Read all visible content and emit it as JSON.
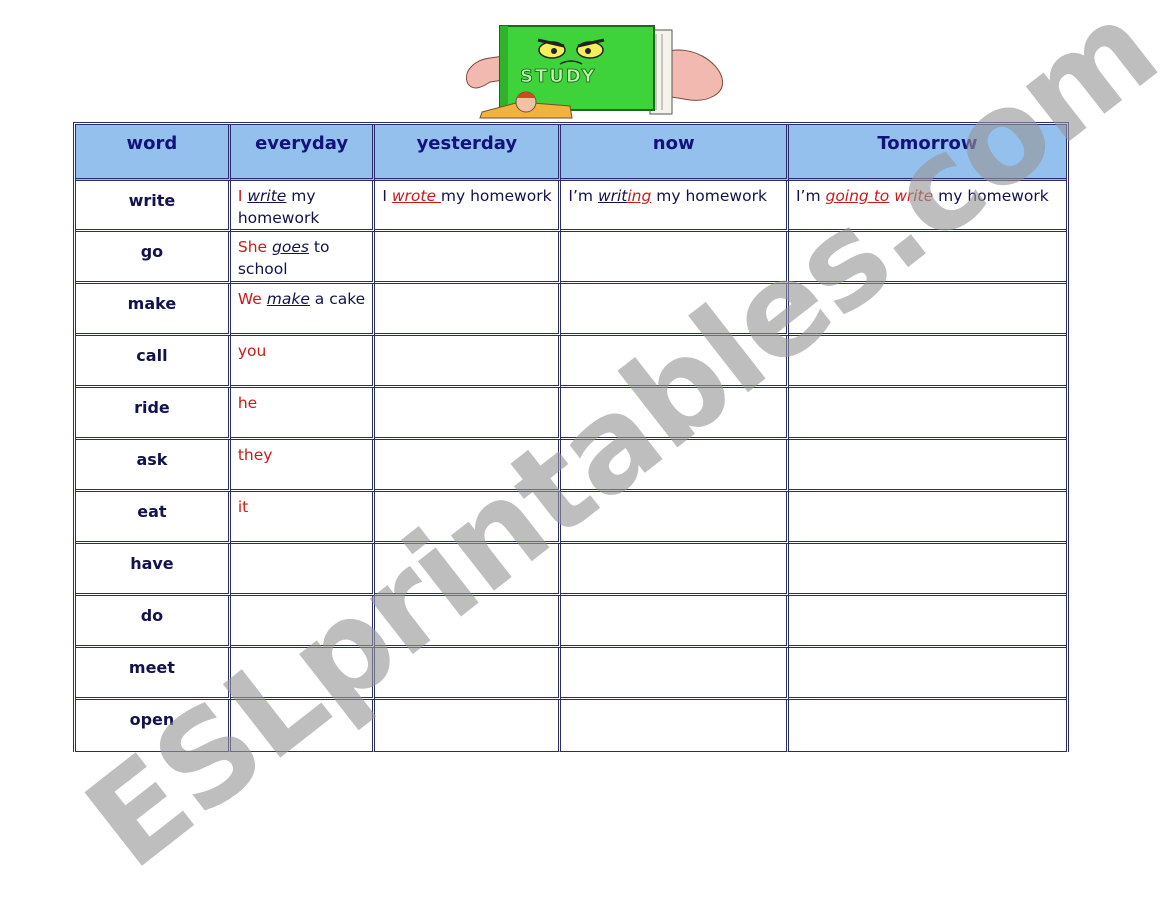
{
  "clipart": {
    "label": "STUDY",
    "icon": "angry-book-clipart"
  },
  "table": {
    "headers": [
      "word",
      "everyday",
      "yesterday",
      "now",
      "Tomorrow"
    ],
    "rows": [
      {
        "word": "write",
        "everyday": {
          "subject": "I",
          "verb": "write",
          "rest": " my homework"
        },
        "yesterday": {
          "subject": "I ",
          "verb": "wrote ",
          "rest": "my homework"
        },
        "now": {
          "subject": "I’m ",
          "verb_stem": "writ",
          "verb_suffix": "ing",
          "rest": " my homework"
        },
        "tomorrow": {
          "subject": "I’m ",
          "aux": "going to",
          "verb": "write",
          "rest": " my homework"
        }
      },
      {
        "word": "go",
        "everyday": {
          "subject": "She",
          "verb": "goes",
          "rest": " to school"
        }
      },
      {
        "word": "make",
        "everyday": {
          "subject": "We",
          "verb": "make",
          "rest": " a cake"
        }
      },
      {
        "word": "call",
        "everyday": {
          "subject": "you"
        }
      },
      {
        "word": "ride",
        "everyday": {
          "subject": "he"
        }
      },
      {
        "word": "ask",
        "everyday": {
          "subject": "they"
        }
      },
      {
        "word": "eat",
        "everyday": {
          "subject": "it"
        }
      },
      {
        "word": "have"
      },
      {
        "word": "do"
      },
      {
        "word": "meet"
      },
      {
        "word": "open"
      }
    ]
  },
  "watermark": "ESLprintables.com",
  "colors": {
    "header_bg": "#94c0ee",
    "header_text": "#12127a",
    "body_text": "#12124e",
    "highlight_red": "#cc1a1a",
    "border": "#2a2d6b"
  }
}
